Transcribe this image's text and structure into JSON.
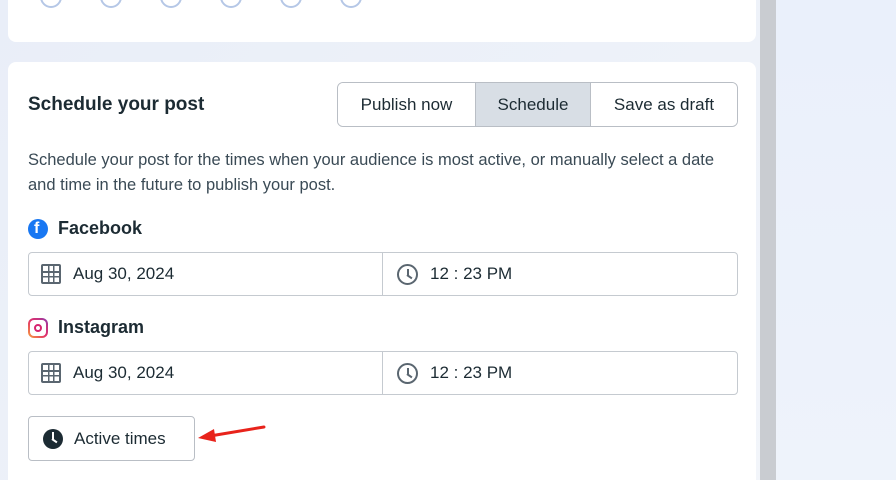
{
  "schedule": {
    "title": "Schedule your post",
    "tabs": [
      {
        "label": "Publish now"
      },
      {
        "label": "Schedule",
        "selected": true
      },
      {
        "label": "Save as draft"
      }
    ],
    "description": "Schedule your post for the times when your audience is most active, or manually select a date and time in the future to publish your post.",
    "platforms": [
      {
        "name": "Facebook",
        "icon": "facebook-icon",
        "date": "Aug 30, 2024",
        "time": "12 : 23 PM"
      },
      {
        "name": "Instagram",
        "icon": "instagram-icon",
        "date": "Aug 30, 2024",
        "time": "12 : 23 PM"
      }
    ],
    "active_times_label": "Active times"
  },
  "colors": {
    "facebook_blue": "#1877f2",
    "selected_tab_bg": "#d8dee5",
    "annotation_arrow": "#e8231b",
    "text_primary": "#1c2b33"
  }
}
